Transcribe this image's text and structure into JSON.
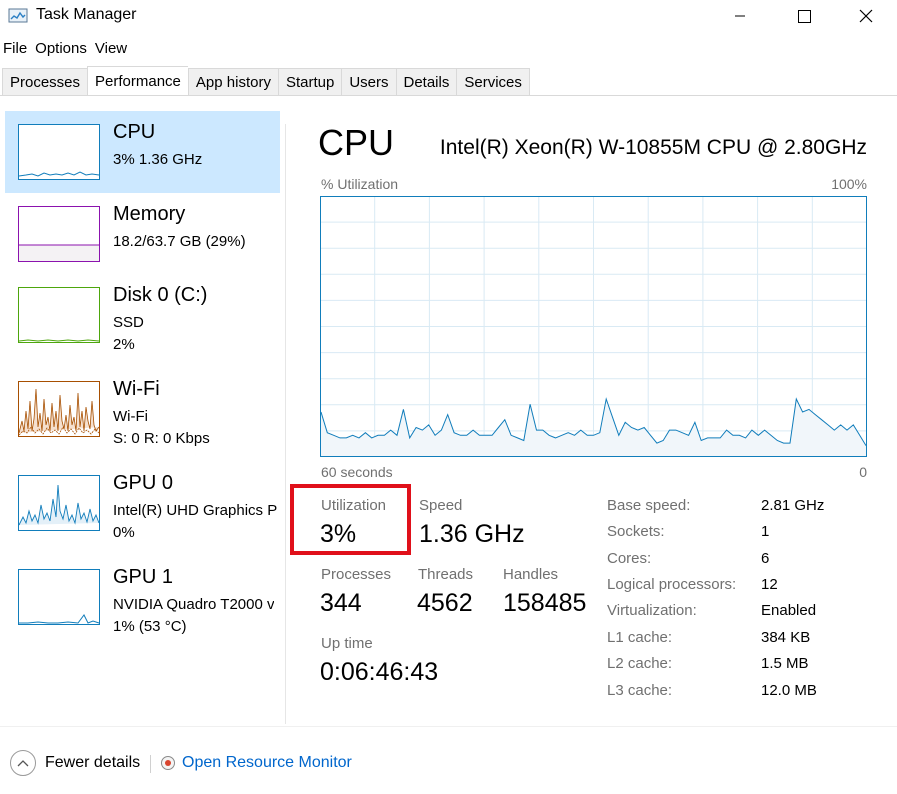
{
  "window": {
    "title": "Task Manager",
    "icon": "task-manager-icon"
  },
  "menu": [
    "File",
    "Options",
    "View"
  ],
  "tabs": [
    {
      "label": "Processes",
      "active": false
    },
    {
      "label": "Performance",
      "active": true
    },
    {
      "label": "App history",
      "active": false
    },
    {
      "label": "Startup",
      "active": false
    },
    {
      "label": "Users",
      "active": false
    },
    {
      "label": "Details",
      "active": false
    },
    {
      "label": "Services",
      "active": false
    }
  ],
  "sidebar": {
    "items": [
      {
        "label": "CPU",
        "line1": "3%  1.36 GHz",
        "line2": "",
        "line3": "",
        "color": "#117dbb",
        "selected": true
      },
      {
        "label": "Memory",
        "line1": "18.2/63.7 GB (29%)",
        "line2": "",
        "line3": "",
        "color": "#8b12ae",
        "selected": false
      },
      {
        "label": "Disk 0 (C:)",
        "line1": "SSD",
        "line2": "2%",
        "line3": "",
        "color": "#4da60c",
        "selected": false
      },
      {
        "label": "Wi-Fi",
        "line1": "Wi-Fi",
        "line2": "S: 0 R: 0 Kbps",
        "line3": "",
        "color": "#a74f01",
        "selected": false
      },
      {
        "label": "GPU 0",
        "line1": "Intel(R) UHD Graphics P",
        "line2": "0%",
        "line3": "",
        "color": "#117dbb",
        "selected": false
      },
      {
        "label": "GPU 1",
        "line1": "NVIDIA Quadro T2000 v",
        "line2": "1% (53 °C)",
        "line3": "",
        "color": "#117dbb",
        "selected": false
      }
    ]
  },
  "main": {
    "title": "CPU",
    "model": "Intel(R) Xeon(R) W-10855M CPU @ 2.80GHz",
    "chart_label": "% Utilization",
    "chart_max": "100%",
    "time_span": "60 seconds",
    "time_end": "0",
    "stats": {
      "utilization_label": "Utilization",
      "utilization_value": "3%",
      "speed_label": "Speed",
      "speed_value": "1.36 GHz",
      "processes_label": "Processes",
      "processes_value": "344",
      "threads_label": "Threads",
      "threads_value": "4562",
      "handles_label": "Handles",
      "handles_value": "158485",
      "uptime_label": "Up time",
      "uptime_value": "0:06:46:43"
    },
    "specs": [
      {
        "label": "Base speed:",
        "value": "2.81 GHz"
      },
      {
        "label": "Sockets:",
        "value": "1"
      },
      {
        "label": "Cores:",
        "value": "6"
      },
      {
        "label": "Logical processors:",
        "value": "12"
      },
      {
        "label": "Virtualization:",
        "value": "Enabled"
      },
      {
        "label": "L1 cache:",
        "value": "384 KB"
      },
      {
        "label": "L2 cache:",
        "value": "1.5 MB"
      },
      {
        "label": "L3 cache:",
        "value": "12.0 MB"
      }
    ]
  },
  "footer": {
    "fewer_details": "Fewer details",
    "open_resource_monitor": "Open Resource Monitor"
  },
  "colors": {
    "cpu_line": "#117dbb",
    "cpu_fill": "#f1f6fa",
    "grid": "#d9eaf4",
    "highlight": "#e0101a",
    "link": "#0066cc",
    "selected_bg": "#cce8ff"
  },
  "chart_data": {
    "type": "area",
    "title": "% Utilization",
    "xlabel": "60 seconds",
    "ylabel": "% Utilization",
    "xlim": [
      60,
      0
    ],
    "ylim": [
      0,
      100
    ],
    "grid": true,
    "series": [
      {
        "values": [
          17,
          9,
          8,
          7,
          7,
          8,
          7,
          9,
          7,
          8,
          8,
          10,
          8,
          18,
          7,
          11,
          10,
          12,
          8,
          10,
          16,
          9,
          8,
          8,
          10,
          8,
          8,
          8,
          11,
          14,
          8,
          7,
          6,
          20,
          10,
          10,
          8,
          7,
          8,
          9,
          8,
          10,
          8,
          8,
          9,
          22,
          15,
          8,
          13,
          11,
          10,
          11,
          8,
          5,
          6,
          10,
          10,
          9,
          8,
          13,
          6,
          7,
          7,
          7,
          10,
          8,
          8,
          7,
          10,
          8,
          10,
          8,
          6,
          5,
          5,
          22,
          17,
          18,
          16,
          14,
          12,
          10,
          12,
          10,
          12,
          8,
          4
        ]
      }
    ]
  }
}
